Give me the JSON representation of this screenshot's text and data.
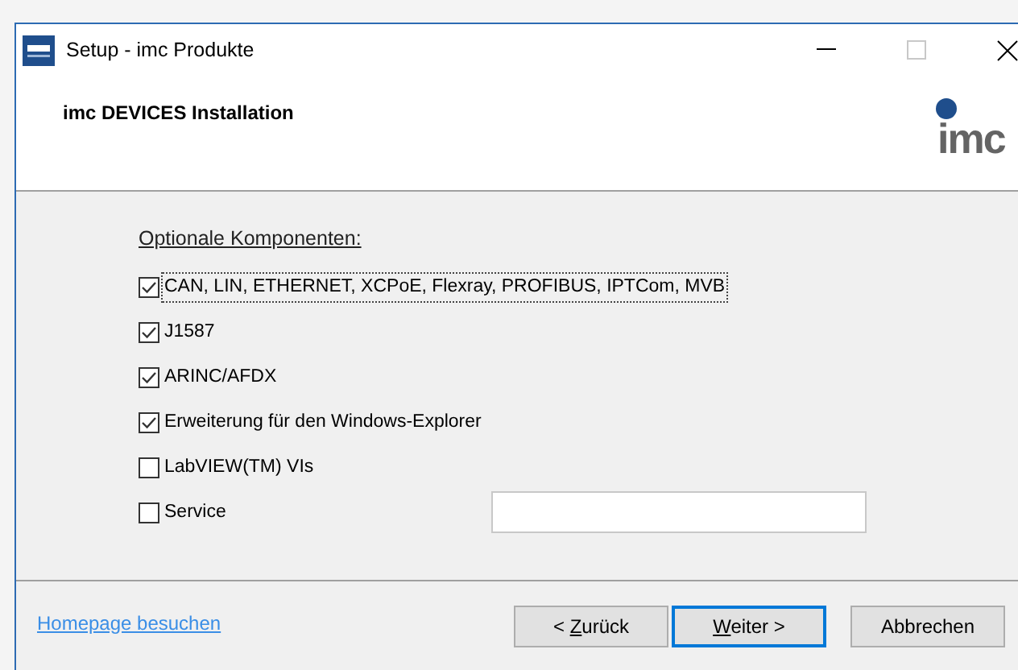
{
  "window": {
    "title": "Setup - imc Produkte"
  },
  "header": {
    "title": "imc DEVICES Installation",
    "logo_text": "imc"
  },
  "section_title": "Optionale Komponenten:",
  "components": [
    {
      "kind": "checkbox",
      "label": "CAN, LIN, ETHERNET, XCPoE, Flexray, PROFIBUS, IPTCom, MVB",
      "checked": true,
      "focused": true
    },
    {
      "kind": "checkbox",
      "label": "J1587",
      "checked": true,
      "focused": false
    },
    {
      "kind": "checkbox",
      "label": "ARINC/AFDX",
      "checked": true,
      "focused": false
    },
    {
      "kind": "checkbox",
      "label": "Erweiterung für den Windows-Explorer",
      "checked": true,
      "focused": false
    },
    {
      "kind": "checkbox",
      "label": "LabVIEW(TM) VIs",
      "checked": false,
      "focused": false
    },
    {
      "kind": "checkbox_field",
      "label": "Service",
      "checked": false,
      "focused": false
    }
  ],
  "footer": {
    "link": "Homepage besuchen",
    "buttons": [
      {
        "pre": "< ",
        "key": "Z",
        "post": "urück",
        "default": false
      },
      {
        "key": "W",
        "post": "eiter >",
        "default": true
      },
      {
        "pre": "Abbrechen",
        "default": false
      }
    ]
  }
}
